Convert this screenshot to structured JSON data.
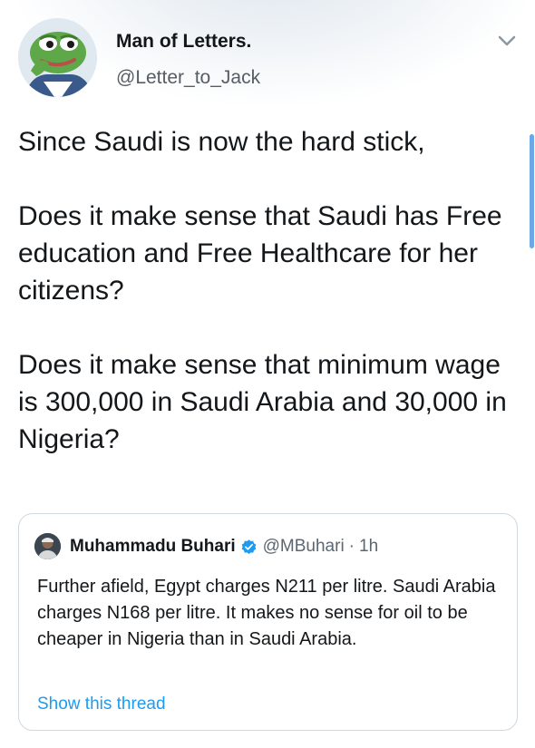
{
  "author": {
    "display_name": "Man of Letters.",
    "handle": "@Letter_to_Jack",
    "avatar_icon": "pepe-frog-avatar"
  },
  "menu": {
    "icon": "chevron-down-icon"
  },
  "tweet": {
    "text": "Since Saudi is now the hard stick,\n\nDoes it make sense that Saudi has Free education and Free Healthcare for her citizens?\n\nDoes it make sense that minimum wage is 300,000 in Saudi Arabia and 30,000 in Nigeria?"
  },
  "quoted_tweet": {
    "display_name": "Muhammadu Buhari",
    "verified_icon": "verified-badge-icon",
    "handle": "@MBuhari",
    "separator": "·",
    "time": "1h",
    "text": "Further afield, Egypt charges N211 per litre. Saudi Arabia charges N168 per litre. It makes no sense for oil to be cheaper in Nigeria than in Saudi Arabia.",
    "show_thread_label": "Show this thread"
  },
  "colors": {
    "link": "#1d9bf0",
    "verified": "#1d9bf0",
    "secondary_text": "#5b6670",
    "scrollbar": "#6aa8e8"
  }
}
